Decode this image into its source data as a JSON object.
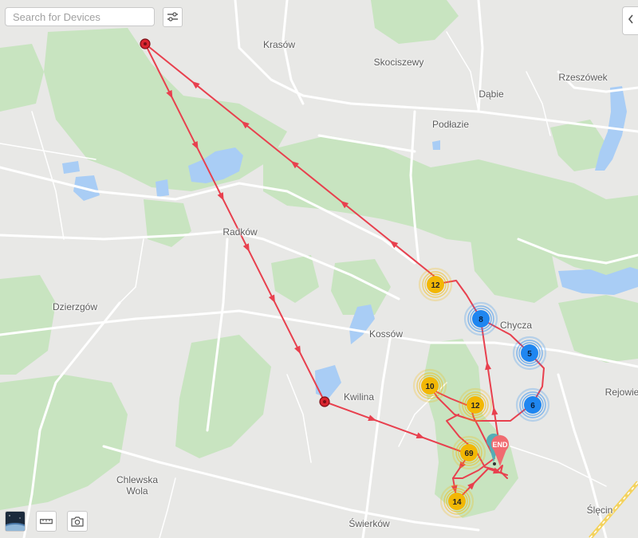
{
  "search": {
    "placeholder": "Search for Devices"
  },
  "places": {
    "krasow": "Krasów",
    "skociszewy": "Skociszewy",
    "rzeszowek": "Rzeszówek",
    "dabie": "Dąbie",
    "podlazie": "Podłazie",
    "radkow": "Radków",
    "dzierzgow": "Dzierzgów",
    "kossow": "Kossów",
    "chycza": "Chycza",
    "kwilina": "Kwilina",
    "rejowiec": "Rejowie",
    "chlewska_wola": "Chlewska\nWola",
    "swierkow": "Świerków",
    "slecin": "Ślęcin"
  },
  "clusters": {
    "c12a": "12",
    "c8": "8",
    "c5": "5",
    "c10": "10",
    "c12b": "12",
    "c6": "6",
    "c69": "69",
    "c14": "14"
  },
  "end_label": "END",
  "colors": {
    "route": "#e8404e",
    "cluster_yellow": "#f2b705",
    "cluster_blue": "#1f86f0",
    "water": "#a9cdf5",
    "forest": "#c8e4c0",
    "end_marker": "#f06b70",
    "start_marker": "#54aeb6"
  },
  "icons": {
    "filter": "sliders-icon",
    "collapse": "chevron-left-icon",
    "layer": "satellite-thumbnail",
    "ruler": "ruler-icon",
    "camera": "camera-icon"
  }
}
